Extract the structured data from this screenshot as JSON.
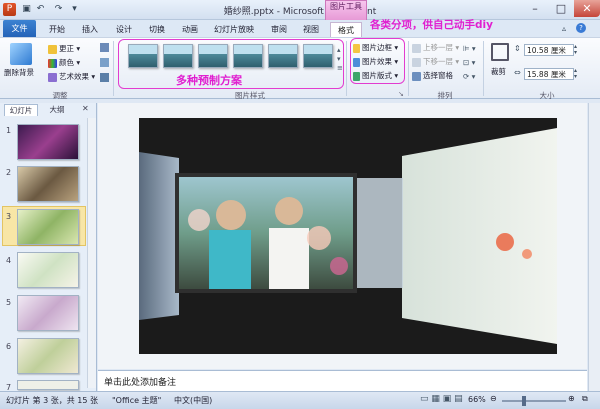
{
  "window": {
    "title": "婚纱照.pptx - Microsoft PowerPoint",
    "context_tab": "图片工具"
  },
  "tabs": [
    "文件",
    "开始",
    "插入",
    "设计",
    "切换",
    "动画",
    "幻灯片放映",
    "审阅",
    "视图",
    "格式"
  ],
  "ribbon": {
    "adjust": {
      "remove_bg": "删除背景",
      "corrections": "更正",
      "color": "颜色",
      "artistic": "艺术效果",
      "label": "调整"
    },
    "styles": {
      "label": "图片样式",
      "annotation": "多种预制方案"
    },
    "picture_opts": {
      "border": "图片边框",
      "effects": "图片效果",
      "layout": "图片版式",
      "annotation": "各类分项，供自己动手diy"
    },
    "arrange": {
      "bring_forward": "上移一层",
      "send_backward": "下移一层",
      "selection_pane": "选择窗格",
      "label": "排列"
    },
    "size": {
      "crop": "裁剪",
      "height": "10.58 厘米",
      "width": "15.88 厘米",
      "label": "大小"
    }
  },
  "left_panel": {
    "tab_slides": "幻灯片",
    "tab_outline": "大纲",
    "slides": [
      "1",
      "2",
      "3",
      "4",
      "5",
      "6",
      "7"
    ]
  },
  "notes_placeholder": "单击此处添加备注",
  "status": {
    "slide_info": "幻灯片 第 3 张，共 15 张",
    "theme": "\"Office 主题\"",
    "language": "中文(中国)",
    "zoom": "66%"
  },
  "colors": {
    "accent": "#2463b8",
    "annotation": "#e01fd0",
    "context": "#e79ad6"
  }
}
